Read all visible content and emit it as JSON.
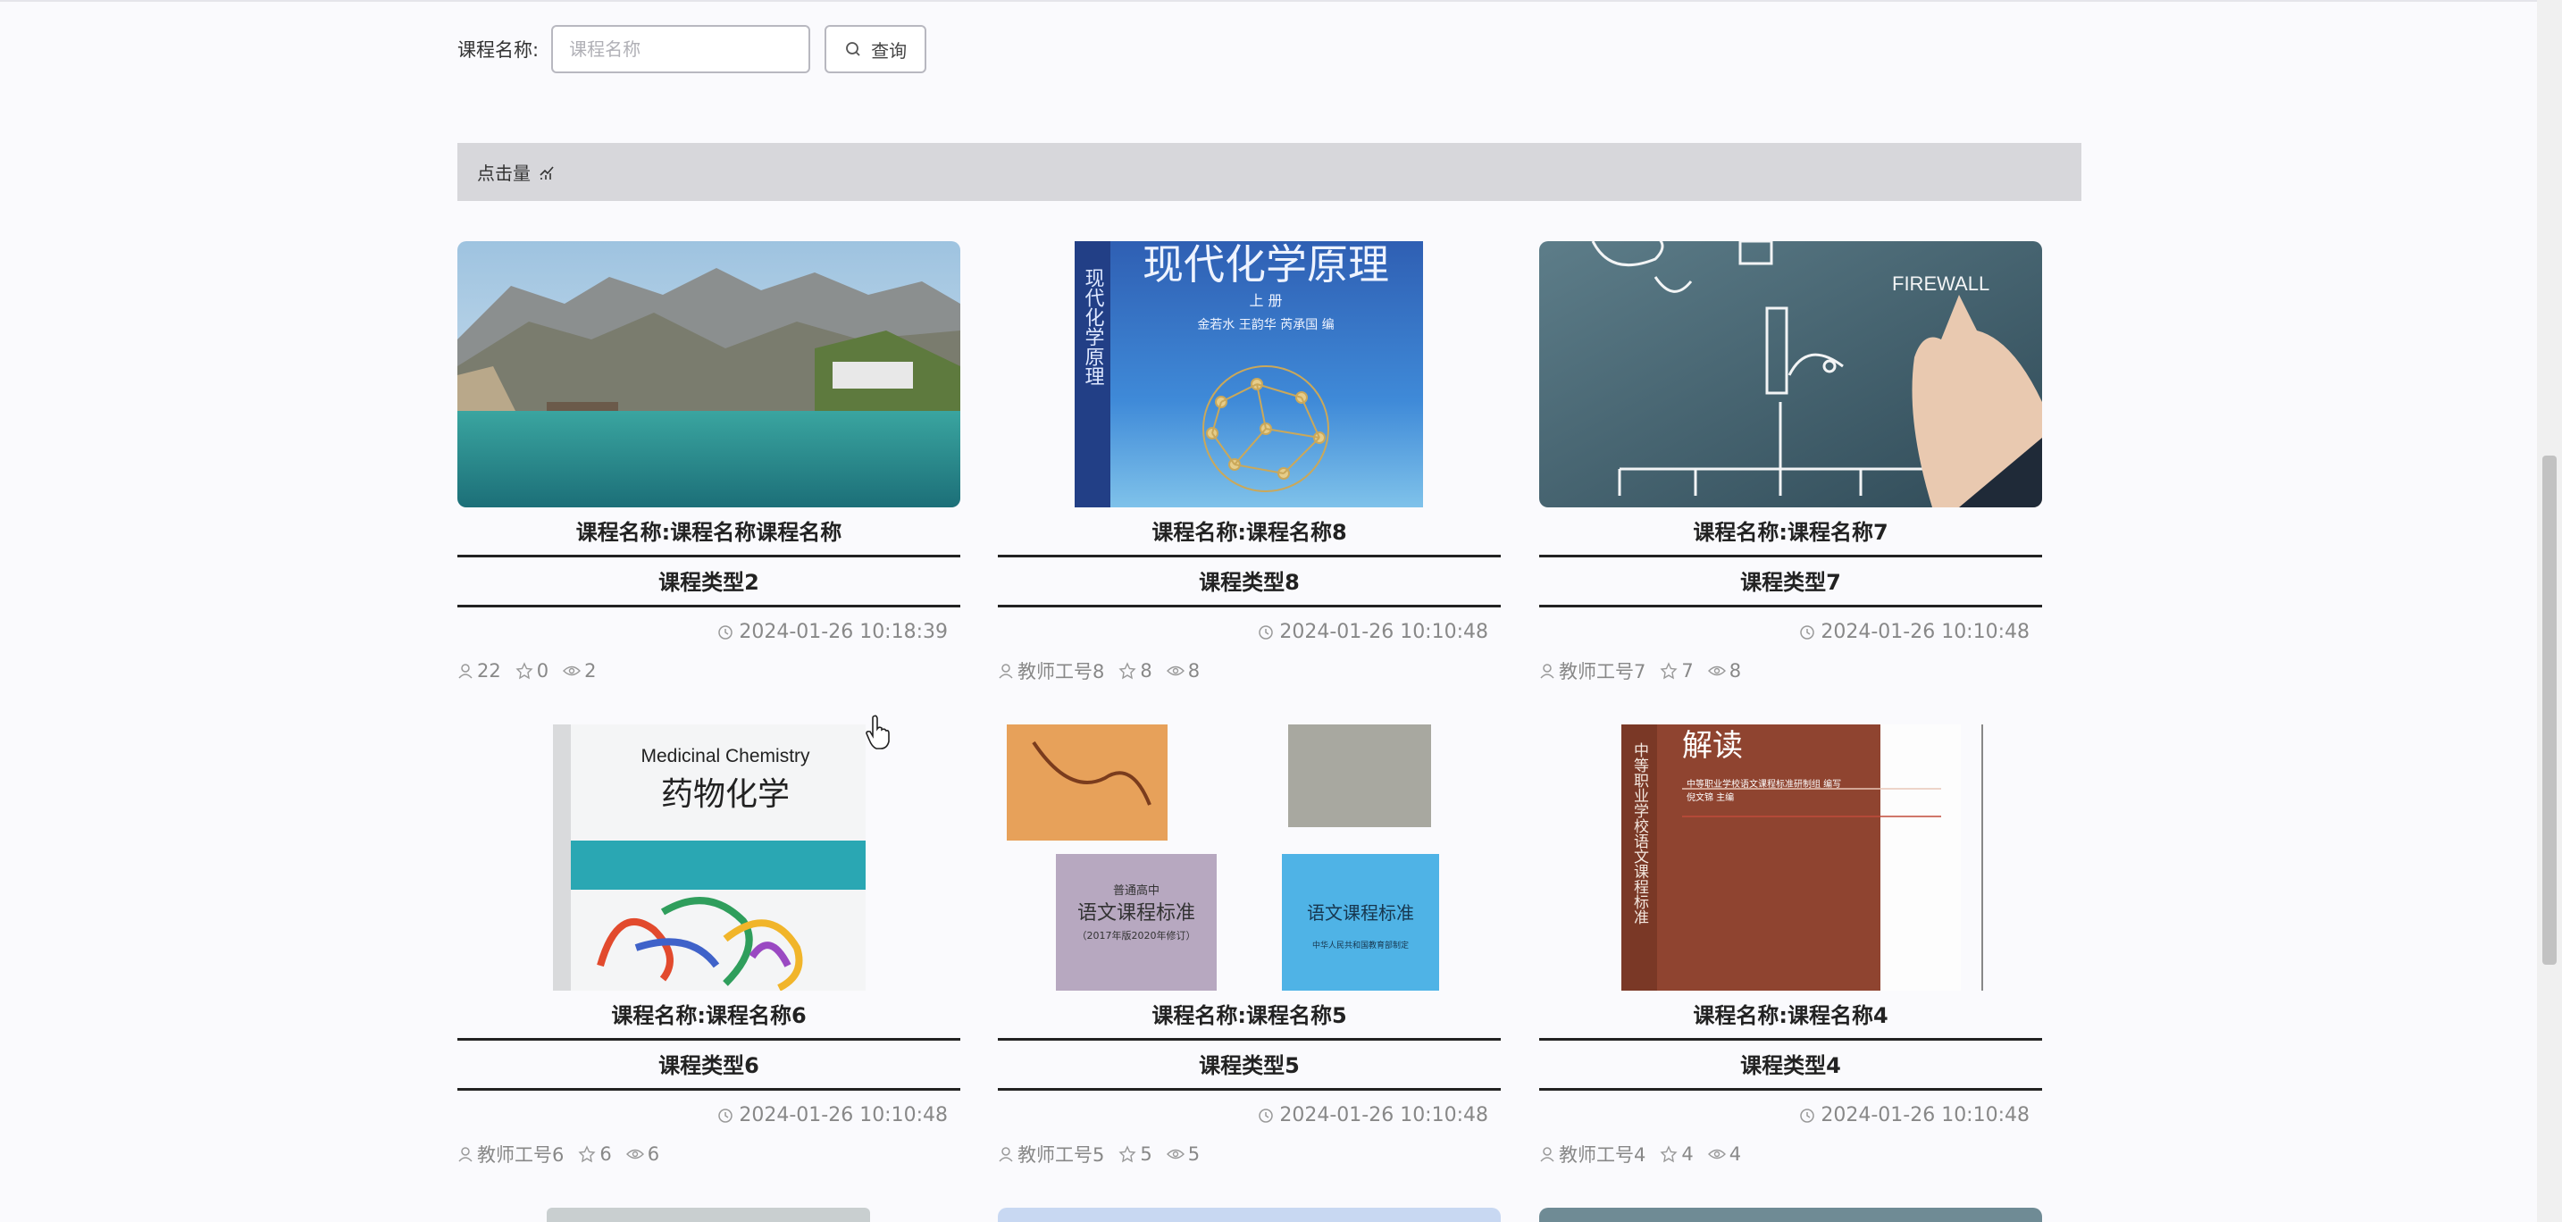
{
  "search": {
    "label": "课程名称:",
    "placeholder": "课程名称",
    "button_label": "查询"
  },
  "sort": {
    "label": "点击量"
  },
  "courses": [
    {
      "title": "课程名称:课程名称课程名称",
      "type": "课程类型2",
      "time": "2024-01-26 10:18:39",
      "teacher": "22",
      "favorites": "0",
      "views": "2",
      "image": "lake-landscape"
    },
    {
      "title": "课程名称:课程名称8",
      "type": "课程类型8",
      "time": "2024-01-26 10:10:48",
      "teacher": "教师工号8",
      "favorites": "8",
      "views": "8",
      "image": "chemistry-book"
    },
    {
      "title": "课程名称:课程名称7",
      "type": "课程类型7",
      "time": "2024-01-26 10:10:48",
      "teacher": "教师工号7",
      "favorites": "7",
      "views": "8",
      "image": "firewall-diagram"
    },
    {
      "title": "课程名称:课程名称6",
      "type": "课程类型6",
      "time": "2024-01-26 10:10:48",
      "teacher": "教师工号6",
      "favorites": "6",
      "views": "6",
      "image": "medicinal-chemistry-book"
    },
    {
      "title": "课程名称:课程名称5",
      "type": "课程类型5",
      "time": "2024-01-26 10:10:48",
      "teacher": "教师工号5",
      "favorites": "5",
      "views": "5",
      "image": "chinese-standards-books"
    },
    {
      "title": "课程名称:课程名称4",
      "type": "课程类型4",
      "time": "2024-01-26 10:10:48",
      "teacher": "教师工号4",
      "favorites": "4",
      "views": "4",
      "image": "brown-book"
    }
  ],
  "book_text": {
    "chem_title": "现代化学原理",
    "chem_vol": "上 册",
    "chem_authors": "金若水 王韵华 芮承国 编",
    "chem_spine": "现代化学原理",
    "firewall": "FIREWALL",
    "med_en": "Medicinal Chemistry",
    "med_cn": "药物化学",
    "std_top": "普通高中",
    "std_title": "语文课程标准",
    "std_year": "（2017年版2020年修订）",
    "std_right": "语文课程标准",
    "std_pub": "中华人民共和国教育部制定",
    "brown_title": "解读",
    "brown_spine": "中等职业学校语文课程标准",
    "brown_sub1": "中等职业学校语文课程标准研制组 编写",
    "brown_sub2": "倪文锦 主编"
  },
  "colors": {
    "sort_bar": "#d7d7db",
    "text_muted": "#888888",
    "border": "#b8b8c0"
  }
}
